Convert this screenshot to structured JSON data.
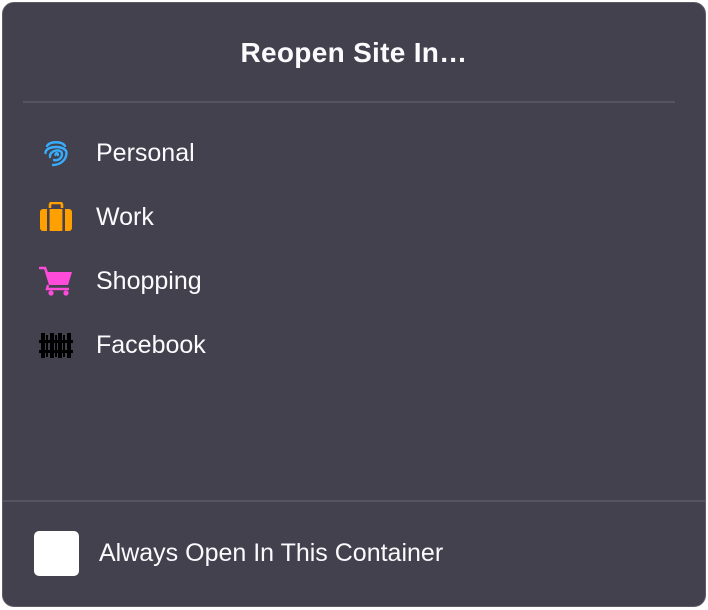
{
  "panel": {
    "title": "Reopen Site In…"
  },
  "containers": [
    {
      "label": "Personal",
      "icon": "fingerprint-icon",
      "color": "#37adff"
    },
    {
      "label": "Work",
      "icon": "briefcase-icon",
      "color": "#ff9f00"
    },
    {
      "label": "Shopping",
      "icon": "cart-icon",
      "color": "#ff4bda"
    },
    {
      "label": "Facebook",
      "icon": "fence-icon",
      "color": "#000000"
    }
  ],
  "footer": {
    "checkbox_label": "Always Open In This Container",
    "checked": false
  }
}
